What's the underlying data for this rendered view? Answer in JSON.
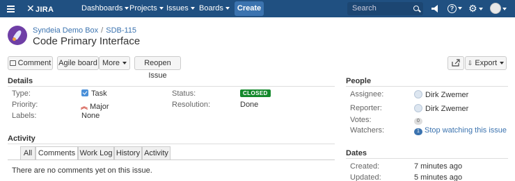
{
  "nav": {
    "logo": "JIRA",
    "links": [
      "Dashboards",
      "Projects",
      "Issues",
      "Boards"
    ],
    "create": "Create",
    "search_placeholder": "Search",
    "help": "?"
  },
  "issue": {
    "project": "Syndeia Demo Box",
    "key": "SDB-115",
    "title": "Code Primary Interface"
  },
  "toolbar": {
    "comment": "Comment",
    "agile_board": "Agile board",
    "more": "More",
    "reopen": "Reopen Issue",
    "export": "Export"
  },
  "details": {
    "heading": "Details",
    "type_label": "Type:",
    "type_value": "Task",
    "status_label": "Status:",
    "status_value": "CLOSED",
    "priority_label": "Priority:",
    "priority_value": "Major",
    "resolution_label": "Resolution:",
    "resolution_value": "Done",
    "labels_label": "Labels:",
    "labels_value": "None"
  },
  "activity": {
    "heading": "Activity",
    "tabs": [
      "All",
      "Comments",
      "Work Log",
      "History",
      "Activity"
    ],
    "active_tab": "Comments",
    "empty_text": "There are no comments yet on this issue."
  },
  "people": {
    "heading": "People",
    "assignee_label": "Assignee:",
    "assignee": "Dirk Zwemer",
    "reporter_label": "Reporter:",
    "reporter": "Dirk Zwemer",
    "votes_label": "Votes:",
    "votes": "0",
    "watchers_label": "Watchers:",
    "watchers_count": "1",
    "watch_link": "Stop watching this issue"
  },
  "dates": {
    "heading": "Dates",
    "created_label": "Created:",
    "created": "7 minutes ago",
    "updated_label": "Updated:",
    "updated": "5 minutes ago"
  },
  "colors": {
    "nav_bg": "#205081",
    "create_bg": "#3b73af",
    "status_closed": "#14892c",
    "link": "#3b73af"
  }
}
